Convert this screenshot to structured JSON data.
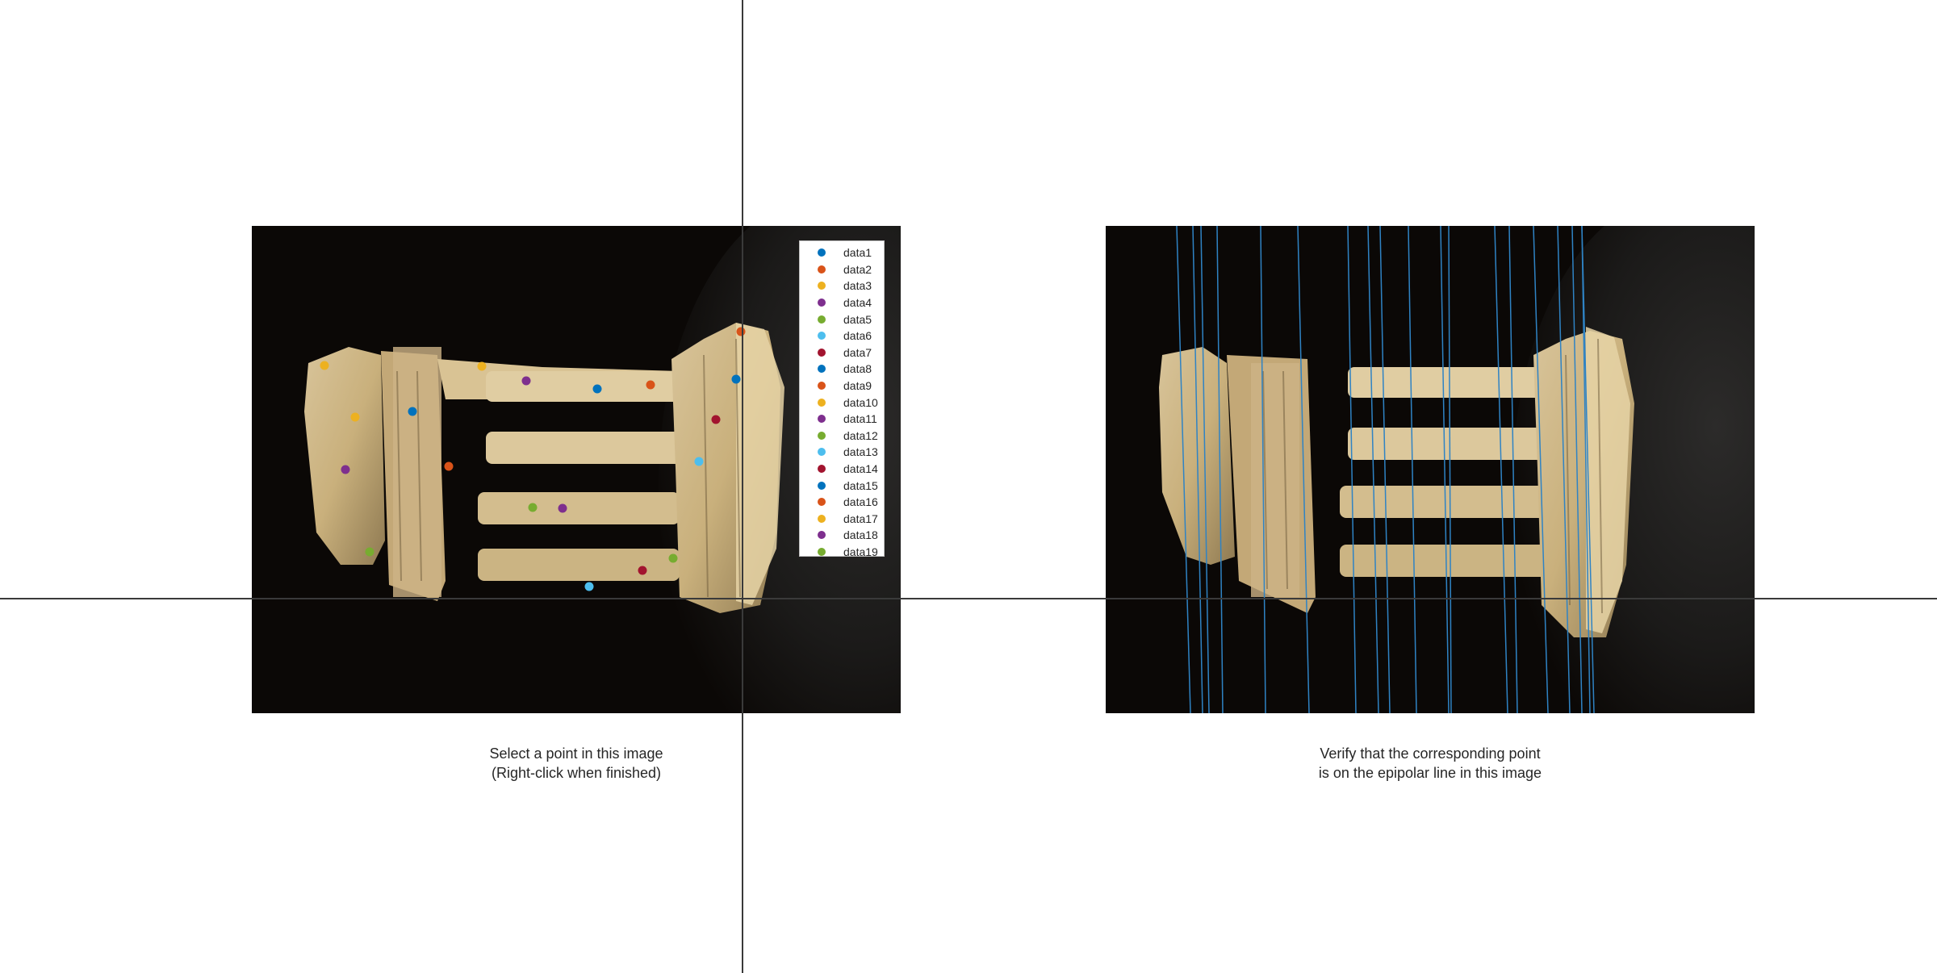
{
  "left_caption": {
    "line1": "Select a point in this image",
    "line2": "(Right-click when finished)"
  },
  "right_caption": {
    "line1": "Verify that the corresponding point",
    "line2": "is on the epipolar line in this image"
  },
  "legend": [
    {
      "label": "data1",
      "color": "#0072BD"
    },
    {
      "label": "data2",
      "color": "#D95319"
    },
    {
      "label": "data3",
      "color": "#EDB120"
    },
    {
      "label": "data4",
      "color": "#7E2F8E"
    },
    {
      "label": "data5",
      "color": "#77AC30"
    },
    {
      "label": "data6",
      "color": "#4DBEEE"
    },
    {
      "label": "data7",
      "color": "#A2142F"
    },
    {
      "label": "data8",
      "color": "#0072BD"
    },
    {
      "label": "data9",
      "color": "#D95319"
    },
    {
      "label": "data10",
      "color": "#EDB120"
    },
    {
      "label": "data11",
      "color": "#7E2F8E"
    },
    {
      "label": "data12",
      "color": "#77AC30"
    },
    {
      "label": "data13",
      "color": "#4DBEEE"
    },
    {
      "label": "data14",
      "color": "#A2142F"
    },
    {
      "label": "data15",
      "color": "#0072BD"
    },
    {
      "label": "data16",
      "color": "#D95319"
    },
    {
      "label": "data17",
      "color": "#EDB120"
    },
    {
      "label": "data18",
      "color": "#7E2F8E"
    },
    {
      "label": "data19",
      "color": "#77AC30"
    }
  ],
  "epipolar_line_color": "#2f83c4"
}
